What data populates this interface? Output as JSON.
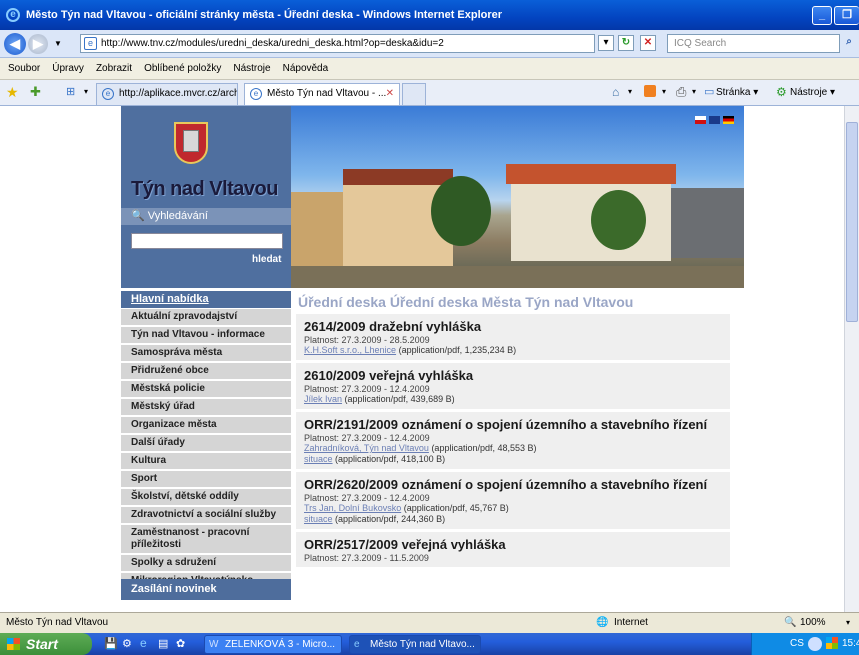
{
  "window": {
    "title": "Město Týn nad Vltavou - oficiální stránky města - Úřední deska - Windows Internet Explorer"
  },
  "address": {
    "url": "http://www.tnv.cz/modules/uredni_deska/uredni_deska.html?op=deska&idu=2",
    "search_placeholder": "ICQ Search"
  },
  "menubar": [
    "Soubor",
    "Úpravy",
    "Zobrazit",
    "Oblíbené položky",
    "Nástroje",
    "Nápověda"
  ],
  "tabs": [
    "http://aplikace.mvcr.cz/archi...",
    "Město Týn nad Vltavou - ..."
  ],
  "command": {
    "page": "Stránka",
    "tools": "Nástroje"
  },
  "site": {
    "city": "Týn nad Vltavou",
    "search_label": "Vyhledávání",
    "search_button": "hledat",
    "menu_header": "Hlavní nabídka",
    "menu": [
      "Aktuální zpravodajství",
      "Týn nad Vltavou - informace",
      "Samospráva města",
      "Přidružené obce",
      "Městská policie",
      "Městský úřad",
      "Organizace města",
      "Další úřady",
      "Kultura",
      "Sport",
      "Školství, dětské oddíly",
      "Zdravotnictví a sociální služby",
      "Zaměstnanost - pracovní příležitosti",
      "Spolky a sdružení",
      "Mikroregion Vltavotýnsko"
    ],
    "newsletter": "Zasílání novinek",
    "heading": "Úřední deska Úřední deska Města Týn nad Vltavou",
    "notices": [
      {
        "title": "2614/2009 dražební vyhláška",
        "validity": "Platnost: 27.3.2009 - 28.5.2009",
        "files": [
          {
            "link": "K.H.Soft s.r.o., Lhenice",
            "info": "(application/pdf, 1,235,234 B)"
          }
        ]
      },
      {
        "title": "2610/2009 veřejná vyhláška",
        "validity": "Platnost: 27.3.2009 - 12.4.2009",
        "files": [
          {
            "link": "Jílek Ivan",
            "info": "(application/pdf, 439,689 B)"
          }
        ]
      },
      {
        "title": "ORR/2191/2009 oznámení o spojení územního a stavebního řízení",
        "validity": "Platnost: 27.3.2009 - 12.4.2009",
        "files": [
          {
            "link": "Zahradníková, Týn nad Vltavou",
            "info": "(application/pdf, 48,553 B)"
          },
          {
            "link": "situace",
            "info": "(application/pdf, 418,100 B)"
          }
        ]
      },
      {
        "title": "ORR/2620/2009 oznámení o spojení územního a stavebního řízení",
        "validity": "Platnost: 27.3.2009 - 12.4.2009",
        "files": [
          {
            "link": "Trs Jan, Dolní Bukovsko",
            "info": "(application/pdf, 45,767 B)"
          },
          {
            "link": "situace",
            "info": "(application/pdf, 244,360 B)"
          }
        ]
      },
      {
        "title": "ORR/2517/2009 veřejná vyhláška",
        "validity": "Platnost: 27.3.2009 - 11.5.2009",
        "files": []
      }
    ]
  },
  "status": {
    "text": "Město Týn nad Vltavou",
    "zone": "Internet",
    "zoom": "100%"
  },
  "taskbar": {
    "start": "Start",
    "tasks": [
      "ZELENKOVÁ 3 - Micro...",
      "Město Týn nad Vltavo..."
    ],
    "lang": "CS",
    "time": "15:4"
  }
}
